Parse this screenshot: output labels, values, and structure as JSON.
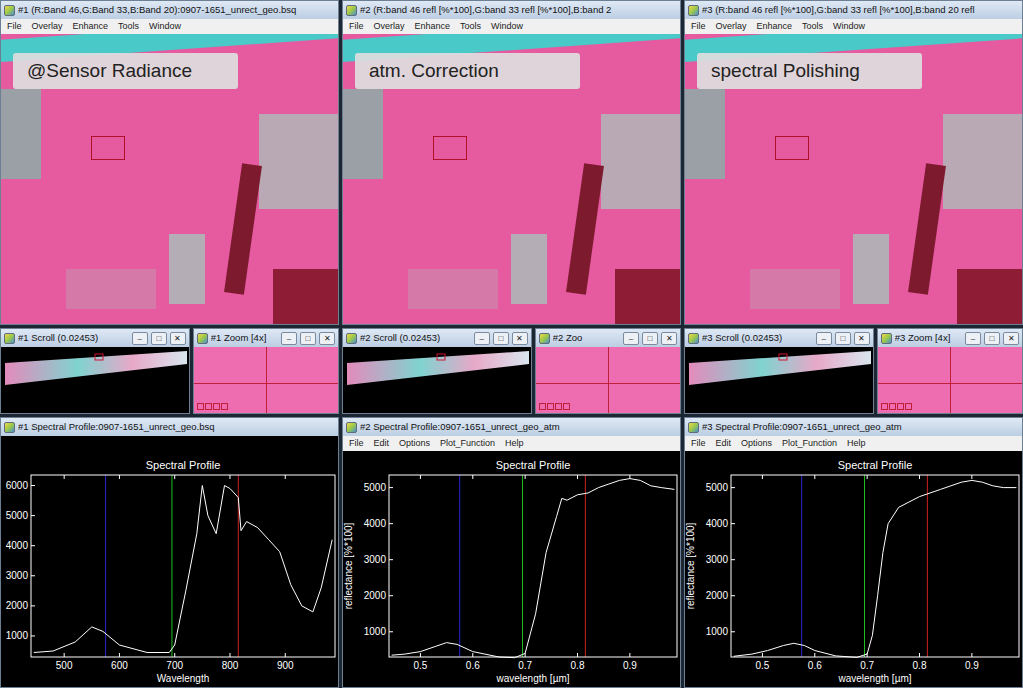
{
  "panels": [
    {
      "image_window": {
        "title": "#1 (R:Band 46,G:Band 33,B:Band 20):0907-1651_unrect_geo.bsq",
        "menu": [
          "File",
          "Overlay",
          "Enhance",
          "Tools",
          "Window"
        ],
        "overlay_label": "@Sensor Radiance"
      },
      "scroll_window": {
        "title": "#1 Scroll (0.02453)",
        "buttons": [
          "–",
          "□",
          "✕"
        ]
      },
      "zoom_window": {
        "title": "#1 Zoom [4x]",
        "buttons": [
          "–",
          "□",
          "✕"
        ]
      },
      "profile_window": {
        "title": "#1 Spectral Profile:0907-1651_unrect_geo.bsq",
        "menu": [],
        "chart": {
          "title": "Spectral Profile",
          "x_label": "Wavelength",
          "x_ticks": [
            "500",
            "600",
            "700",
            "800",
            "900"
          ],
          "y_ticks": [
            "1000",
            "2000",
            "3000",
            "4000",
            "5000",
            "6000"
          ],
          "series": [
            {
              "x": [
                445,
                480,
                520,
                550,
                570,
                600,
                650,
                690,
                700,
                720,
                740,
                750,
                760,
                775,
                790,
                800,
                815,
                820,
                830,
                840,
                850,
                870,
                890,
                910,
                930,
                950,
                965,
                985
              ],
              "y": [
                450,
                500,
                800,
                1300,
                1150,
                700,
                450,
                450,
                700,
                2500,
                4400,
                6000,
                5000,
                4400,
                6000,
                5900,
                5600,
                4500,
                4800,
                4700,
                4600,
                4200,
                3800,
                2700,
                2000,
                1800,
                2600,
                4200
              ]
            }
          ],
          "band_markers": [
            {
              "x": 575,
              "color": "#2828d0"
            },
            {
              "x": 695,
              "color": "#20c020"
            },
            {
              "x": 815,
              "color": "#d02020"
            }
          ]
        }
      }
    },
    {
      "image_window": {
        "title": "#2 (R:band 46 refl [%*100],G:band 33 refl [%*100],B:band 2",
        "menu": [
          "File",
          "Overlay",
          "Enhance",
          "Tools",
          "Window"
        ],
        "overlay_label": "atm. Correction"
      },
      "scroll_window": {
        "title": "#2 Scroll (0.02453)",
        "buttons": [
          "–",
          "□",
          "✕"
        ]
      },
      "zoom_window": {
        "title": "#2 Zoo",
        "buttons": [
          "–",
          "□",
          "✕"
        ]
      },
      "profile_window": {
        "title": "#2 Spectral Profile:0907-1651_unrect_geo_atm",
        "menu": [
          "File",
          "Edit",
          "Options",
          "Plot_Function",
          "Help"
        ],
        "chart": {
          "title": "Spectral Profile",
          "x_label": "wavelength [µm]",
          "y_label": "reflectance [%*100]",
          "x_ticks": [
            "0.5",
            "0.6",
            "0.7",
            "0.8",
            "0.9"
          ],
          "y_ticks": [
            "1000",
            "2000",
            "3000",
            "4000",
            "5000"
          ],
          "series": [
            {
              "x": [
                0.445,
                0.47,
                0.5,
                0.53,
                0.55,
                0.57,
                0.6,
                0.65,
                0.68,
                0.7,
                0.72,
                0.74,
                0.76,
                0.77,
                0.78,
                0.8,
                0.82,
                0.84,
                0.86,
                0.88,
                0.9,
                0.92,
                0.94,
                0.96,
                0.985
              ],
              "y": [
                350,
                380,
                450,
                600,
                700,
                650,
                450,
                300,
                280,
                400,
                1500,
                3200,
                4200,
                4700,
                4650,
                4800,
                4850,
                5000,
                5100,
                5200,
                5250,
                5200,
                5050,
                5000,
                4950
              ]
            }
          ],
          "band_markers": [
            {
              "x": 0.575,
              "color": "#2828d0"
            },
            {
              "x": 0.695,
              "color": "#20c020"
            },
            {
              "x": 0.815,
              "color": "#d02020"
            }
          ]
        }
      }
    },
    {
      "image_window": {
        "title": "#3 (R:band 46 refl [%*100],G:band 33 refl [%*100],B:band 20 refl",
        "menu": [
          "File",
          "Overlay",
          "Enhance",
          "Tools",
          "Window"
        ],
        "overlay_label": "spectral Polishing"
      },
      "scroll_window": {
        "title": "#3 Scroll (0.02453)",
        "buttons": [
          "–",
          "□",
          "✕"
        ]
      },
      "zoom_window": {
        "title": "#3 Zoom [4x]",
        "buttons": [
          "–",
          "□",
          "✕"
        ]
      },
      "profile_window": {
        "title": "#3 Spectral Profile:0907-1651_unrect_geo_atm",
        "menu": [
          "File",
          "Edit",
          "Options",
          "Plot_Function",
          "Help"
        ],
        "chart": {
          "title": "Spectral Profile",
          "x_label": "wavelength [µm]",
          "y_label": "reflectance [%*100]",
          "x_ticks": [
            "0.5",
            "0.6",
            "0.7",
            "0.8",
            "0.9"
          ],
          "y_ticks": [
            "1000",
            "2000",
            "3000",
            "4000",
            "5000"
          ],
          "series": [
            {
              "x": [
                0.445,
                0.48,
                0.51,
                0.54,
                0.56,
                0.58,
                0.6,
                0.64,
                0.68,
                0.7,
                0.71,
                0.72,
                0.73,
                0.74,
                0.76,
                0.78,
                0.8,
                0.82,
                0.84,
                0.86,
                0.88,
                0.9,
                0.92,
                0.94,
                0.96,
                0.985
              ],
              "y": [
                320,
                380,
                480,
                620,
                680,
                620,
                480,
                330,
                290,
                380,
                900,
                2000,
                3200,
                4000,
                4450,
                4600,
                4750,
                4850,
                4950,
                5050,
                5150,
                5200,
                5150,
                5050,
                5000,
                5000
              ]
            }
          ],
          "band_markers": [
            {
              "x": 0.575,
              "color": "#2828d0"
            },
            {
              "x": 0.695,
              "color": "#20c020"
            },
            {
              "x": 0.815,
              "color": "#d02020"
            }
          ]
        }
      }
    }
  ]
}
